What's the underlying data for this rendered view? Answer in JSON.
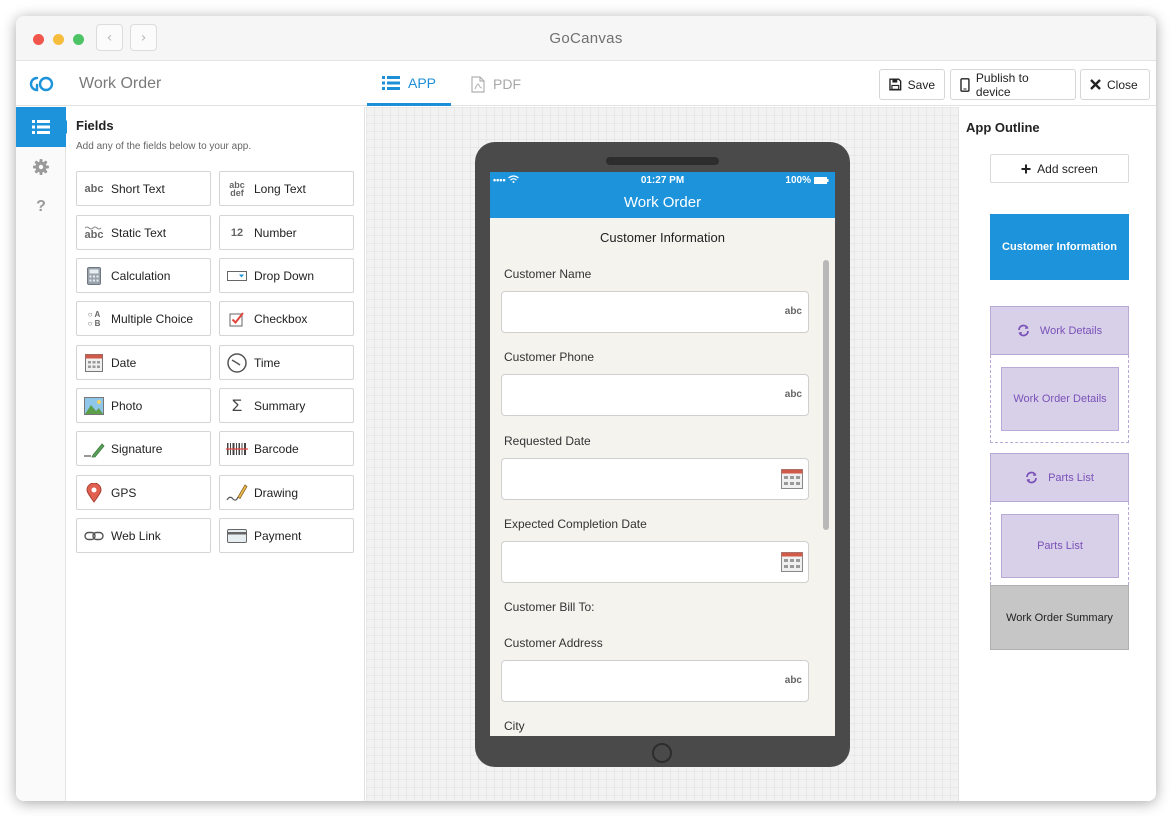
{
  "window": {
    "title": "GoCanvas"
  },
  "header": {
    "app_title": "Work Order",
    "tabs": [
      {
        "label": "APP",
        "active": true
      },
      {
        "label": "PDF",
        "active": false
      }
    ],
    "save_label": "Save",
    "publish_label": "Publish to device",
    "close_label": "Close"
  },
  "rail": {
    "help_glyph": "?"
  },
  "fields_panel": {
    "title": "Fields",
    "subtitle": "Add any of the fields below to your app.",
    "fields": [
      {
        "label": "Short Text",
        "icon": "abc-icon"
      },
      {
        "label": "Long Text",
        "icon": "abc-def-icon"
      },
      {
        "label": "Static Text",
        "icon": "static-abc-icon"
      },
      {
        "label": "Number",
        "icon": "number-icon"
      },
      {
        "label": "Calculation",
        "icon": "calculator-icon"
      },
      {
        "label": "Drop Down",
        "icon": "dropdown-icon"
      },
      {
        "label": "Multiple Choice",
        "icon": "multiple-choice-icon"
      },
      {
        "label": "Checkbox",
        "icon": "checkbox-icon"
      },
      {
        "label": "Date",
        "icon": "calendar-icon"
      },
      {
        "label": "Time",
        "icon": "clock-icon"
      },
      {
        "label": "Photo",
        "icon": "photo-icon"
      },
      {
        "label": "Summary",
        "icon": "sigma-icon"
      },
      {
        "label": "Signature",
        "icon": "signature-icon"
      },
      {
        "label": "Barcode",
        "icon": "barcode-icon"
      },
      {
        "label": "GPS",
        "icon": "map-pin-icon"
      },
      {
        "label": "Drawing",
        "icon": "pencil-icon"
      },
      {
        "label": "Web Link",
        "icon": "link-icon"
      },
      {
        "label": "Payment",
        "icon": "credit-card-icon"
      }
    ],
    "icon_text": {
      "abc": "abc",
      "abc_top": "abc",
      "abc_bottom": "def",
      "number": "12",
      "sigma": "Σ",
      "choice_a": "A",
      "choice_b": "B"
    }
  },
  "phone": {
    "status_left": "•••• ",
    "time": "01:27 PM",
    "battery": "100%",
    "title": "Work Order",
    "screen_heading": "Customer Information",
    "input_hint": "abc",
    "fields": [
      {
        "label": "Customer Name",
        "type": "text"
      },
      {
        "label": "Customer Phone",
        "type": "text"
      },
      {
        "label": "Requested Date",
        "type": "date"
      },
      {
        "label": "Expected Completion Date",
        "type": "date"
      },
      {
        "label": "Customer Bill To:",
        "type": "static"
      },
      {
        "label": "Customer Address",
        "type": "text"
      },
      {
        "label": "City",
        "type": "text"
      }
    ]
  },
  "outline": {
    "title": "App Outline",
    "add_screen_label": "Add screen",
    "screens": [
      {
        "label": "Customer Information",
        "state": "active"
      },
      {
        "label": "Work Details",
        "state": "loop",
        "children": [
          "Work Order Details"
        ]
      },
      {
        "label": "Parts List",
        "state": "loop",
        "children": [
          "Parts List"
        ]
      },
      {
        "label": "Work Order Summary",
        "state": "default"
      }
    ]
  },
  "colors": {
    "accent": "#1c93db",
    "loop_fill": "#d8cfe8",
    "loop_text": "#7a52b8",
    "summary_fill": "#c6c6c6"
  }
}
